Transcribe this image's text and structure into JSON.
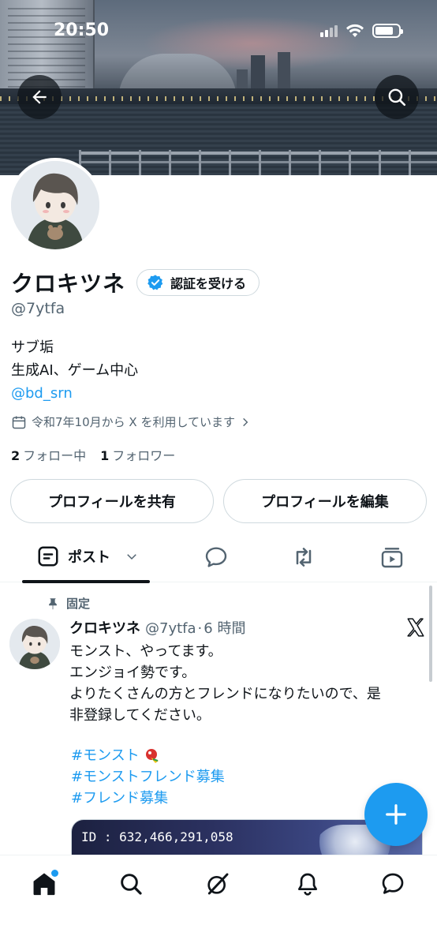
{
  "status_bar": {
    "time": "20:50"
  },
  "profile": {
    "display_name": "クロキツネ",
    "verify_label": "認証を受ける",
    "handle": "@7ytfa",
    "bio_lines": [
      "サブ垢",
      "生成AI、ゲーム中心"
    ],
    "bio_link": "@bd_srn",
    "joined": "令和7年10月から X を利用しています",
    "following_count": "2",
    "following_label": "フォロー中",
    "followers_count": "1",
    "followers_label": "フォロワー"
  },
  "actions": {
    "share_label": "プロフィールを共有",
    "edit_label": "プロフィールを編集"
  },
  "tabs": {
    "active_label": "ポスト"
  },
  "pinned_post": {
    "pinned_label": "固定",
    "author_name": "クロキツネ",
    "author_handle": "@7ytfa",
    "separator": "·",
    "time": "6 時間",
    "text_lines": [
      "モンスト、やってます。",
      "エンジョイ勢です。",
      "よりたくさんの方とフレンドになりたいので、是",
      "非登録してください。"
    ],
    "hashtags": [
      "#モンスト",
      "#モンストフレンド募集",
      "#フレンド募集"
    ],
    "media_text": "ID : 632,466,291,058"
  },
  "colors": {
    "accent": "#1d9bf0",
    "text": "#0f1419",
    "secondary": "#536471",
    "border": "#cfd9de"
  },
  "icons": {
    "back": "arrow-left-icon",
    "search": "search-icon",
    "verify": "verified-badge-icon",
    "calendar": "calendar-icon",
    "pin": "pin-icon",
    "x_logo": "x-logo-icon",
    "compose": "plus-icon",
    "home": "home-icon",
    "grok": "grok-icon",
    "bell": "bell-icon",
    "messages": "message-icon"
  }
}
